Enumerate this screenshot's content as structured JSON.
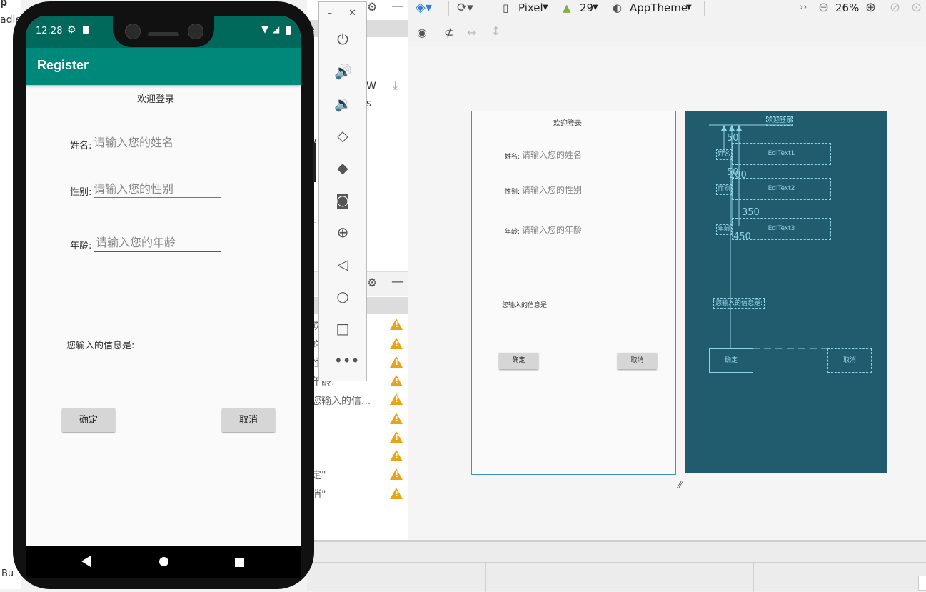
{
  "ide": {
    "left_fragments": [
      "p",
      "adle"
    ],
    "mid_fragments": [
      "e",
      "u",
      "n",
      "e",
      "f",
      "c",
      "w"
    ],
    "mid_extra": [
      "W",
      "s"
    ],
    "component_tree": [
      "欢",
      "姓",
      "性",
      "年龄:",
      "您输入的信...",
      "",
      "",
      "",
      "定\"",
      "消\""
    ],
    "bottom_label": "Bu",
    "toolbar": {
      "device": "Pixel",
      "api": "29",
      "theme": "AppTheme",
      "zoom": "26%",
      "more": "››"
    }
  },
  "emulator_tools": [
    "power-icon",
    "volume-up-icon",
    "volume-down-icon",
    "rotate-left-icon",
    "rotate-right-icon",
    "camera-icon",
    "zoom-icon",
    "back-icon",
    "home-icon",
    "overview-icon",
    "more-icon"
  ],
  "phone": {
    "time": "12:28",
    "app_title": "Register",
    "header": "欢迎登录",
    "fields": [
      {
        "label": "姓名:",
        "placeholder": "请输入您的姓名"
      },
      {
        "label": "性别:",
        "placeholder": "请输入您的性别"
      },
      {
        "label": "年龄:",
        "placeholder": "请输入您的年龄"
      }
    ],
    "info_text": "您输入的信息是:",
    "confirm": "确定",
    "cancel": "取消"
  },
  "blueprint": {
    "edit1": "EdiText1",
    "edit2": "EdiText2",
    "edit3": "EdiText3",
    "title_box": "欢迎登录",
    "label1": "姓名",
    "label2": "性别",
    "label3": "年龄",
    "info_box": "您输入的信息是:",
    "btn_ok": "确定",
    "btn_cancel": "取消",
    "nums": [
      "50",
      "50",
      "200",
      "350",
      "450"
    ]
  },
  "colors": {
    "status": "#00695c",
    "appbar": "#00897b",
    "accent": "#d81b60",
    "blueprint": "#215c6e"
  }
}
